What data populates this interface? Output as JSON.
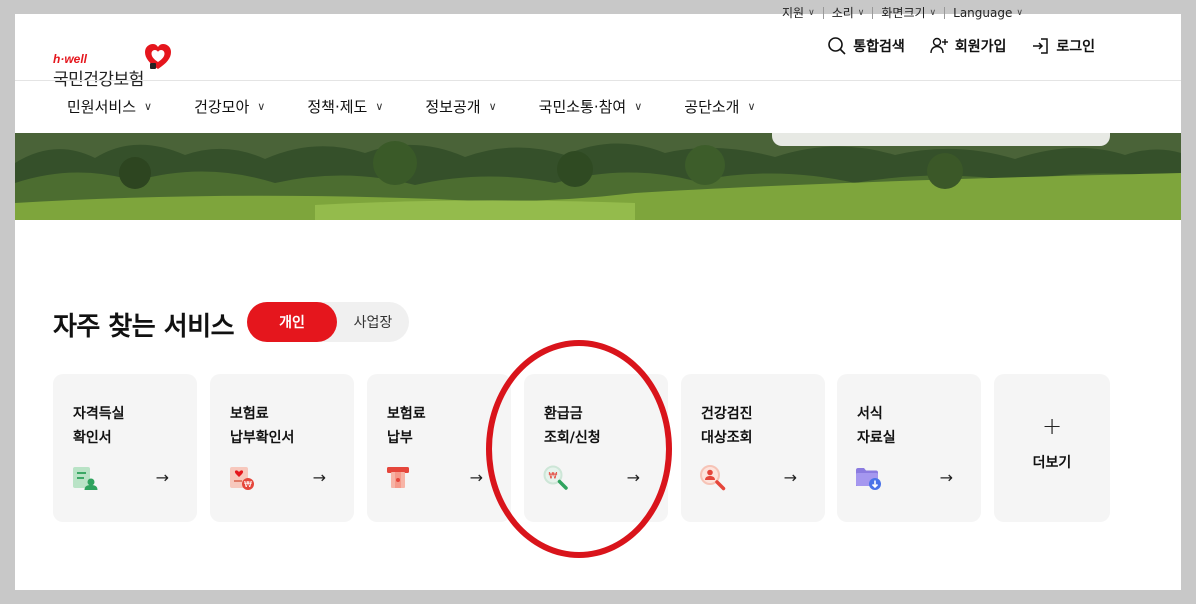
{
  "utility": {
    "items": [
      {
        "label": "지원"
      },
      {
        "label": "소리"
      },
      {
        "label": "화면크기"
      },
      {
        "label": "Language"
      }
    ]
  },
  "logo": {
    "sub": "h·well",
    "main": "국민건강보험"
  },
  "header_actions": {
    "search": "통합검색",
    "signup": "회원가입",
    "login": "로그인"
  },
  "gnb": [
    {
      "label": "민원서비스"
    },
    {
      "label": "건강모아"
    },
    {
      "label": "정책·제도"
    },
    {
      "label": "정보공개"
    },
    {
      "label": "국민소통·참여"
    },
    {
      "label": "공단소개"
    }
  ],
  "services": {
    "title": "자주 찾는 서비스",
    "toggle_active": "개인",
    "toggle_inactive": "사업장",
    "cards": [
      {
        "label": "자격득실\n확인서",
        "icon": "certificate-icon"
      },
      {
        "label": "보험료\n납부확인서",
        "icon": "payment-confirm-icon"
      },
      {
        "label": "보험료\n납부",
        "icon": "payment-icon"
      },
      {
        "label": "환급금\n조회/신청",
        "icon": "refund-search-icon"
      },
      {
        "label": "건강검진\n대상조회",
        "icon": "checkup-search-icon"
      },
      {
        "label": "서식\n자료실",
        "icon": "folder-download-icon"
      }
    ],
    "more": {
      "plus": "+",
      "label": "더보기"
    },
    "arrow": "→"
  },
  "colors": {
    "brand_red": "#e5161d",
    "card_bg": "#f5f5f5",
    "annotation_red": "#d9141b"
  }
}
